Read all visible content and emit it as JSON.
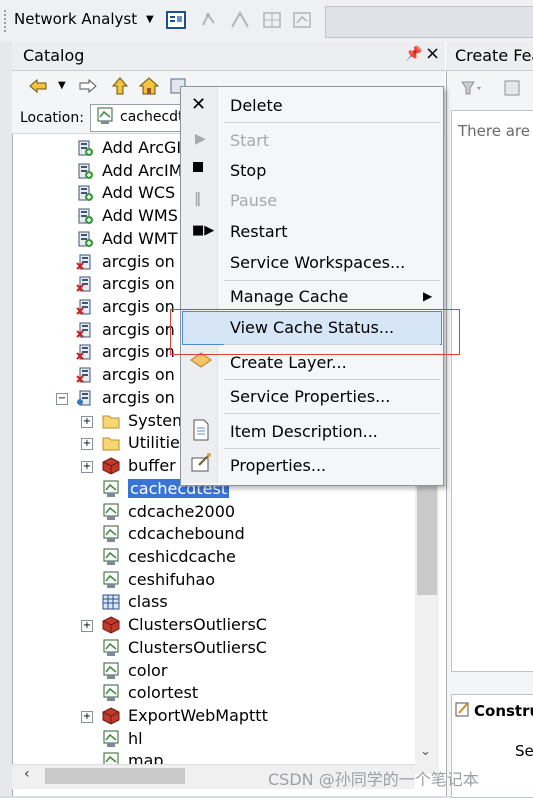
{
  "toolbar": {
    "title": "Network Analyst"
  },
  "catalog": {
    "title": "Catalog",
    "location_label": "Location:",
    "location_value": "cachecdt",
    "tree": [
      {
        "label": "Add ArcGI",
        "icon": "add-server-icon"
      },
      {
        "label": "Add ArcIM",
        "icon": "add-server-icon"
      },
      {
        "label": "Add WCS",
        "icon": "add-server-icon"
      },
      {
        "label": "Add WMS",
        "icon": "add-server-icon"
      },
      {
        "label": "Add WMT",
        "icon": "add-server-icon"
      },
      {
        "label": "arcgis on",
        "icon": "disconnected-server-icon"
      },
      {
        "label": "arcgis on",
        "icon": "disconnected-server-icon"
      },
      {
        "label": "arcgis on",
        "icon": "disconnected-server-icon"
      },
      {
        "label": "arcgis on",
        "icon": "disconnected-server-icon"
      },
      {
        "label": "arcgis on",
        "icon": "disconnected-server-icon"
      },
      {
        "label": "arcgis on",
        "icon": "disconnected-server-icon"
      },
      {
        "label": "arcgis on",
        "icon": "connected-server-icon"
      },
      {
        "label": "System",
        "icon": "folder-icon"
      },
      {
        "label": "Utilities",
        "icon": "folder-icon"
      },
      {
        "label": "buffer",
        "icon": "gp-service-icon"
      },
      {
        "label": "cachecdtest",
        "icon": "map-service-icon"
      },
      {
        "label": "cdcache2000",
        "icon": "map-service-icon"
      },
      {
        "label": "cdcachebound",
        "icon": "map-service-icon"
      },
      {
        "label": "ceshicdcache",
        "icon": "map-service-icon"
      },
      {
        "label": "ceshifuhao",
        "icon": "map-service-icon"
      },
      {
        "label": "class",
        "icon": "table-icon"
      },
      {
        "label": "ClustersOutliersC",
        "icon": "gp-service-icon"
      },
      {
        "label": "ClustersOutliersC",
        "icon": "map-service-icon"
      },
      {
        "label": "color",
        "icon": "map-service-icon"
      },
      {
        "label": "colortest",
        "icon": "map-service-icon"
      },
      {
        "label": "ExportWebMapttt",
        "icon": "gp-service-icon"
      },
      {
        "label": "hl",
        "icon": "map-service-icon"
      },
      {
        "label": "map",
        "icon": "map-service-icon"
      }
    ]
  },
  "right_panel": {
    "title": "Create Fea",
    "note": "There are",
    "construct": "Constru",
    "select": "Se"
  },
  "context_menu": {
    "items": [
      {
        "label": "Delete",
        "enabled": true
      },
      {
        "label": "Start",
        "enabled": false
      },
      {
        "label": "Stop",
        "enabled": true
      },
      {
        "label": "Pause",
        "enabled": false
      },
      {
        "label": "Restart",
        "enabled": true
      },
      {
        "label": "Service Workspaces...",
        "enabled": true
      },
      {
        "label": "Manage Cache",
        "enabled": true
      },
      {
        "label": "View Cache Status...",
        "enabled": true
      },
      {
        "label": "Create Layer...",
        "enabled": true
      },
      {
        "label": "Service Properties...",
        "enabled": true
      },
      {
        "label": "Item Description...",
        "enabled": true
      },
      {
        "label": "Properties...",
        "enabled": true
      }
    ]
  },
  "watermark": "CSDN @孙同学的一个笔记本",
  "colors": {
    "selection": "#3875d7",
    "highlight_border": "#4b8bd6",
    "annotation_box": "#e03c3c"
  }
}
